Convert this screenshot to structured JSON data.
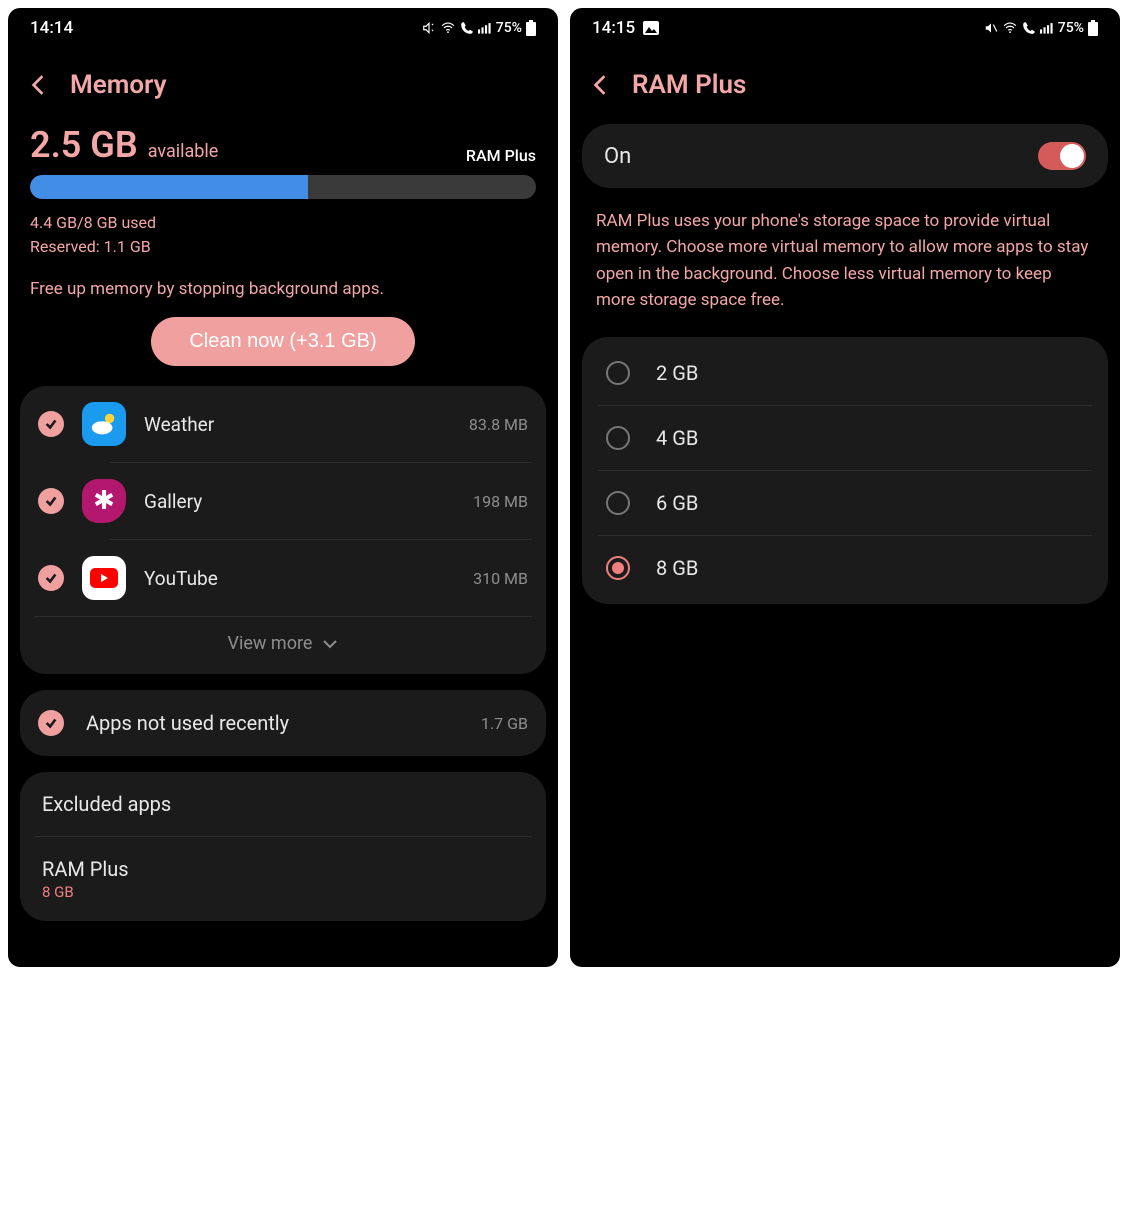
{
  "left": {
    "status": {
      "time": "14:14",
      "battery": "75%"
    },
    "title": "Memory",
    "available": {
      "big": "2.5 GB",
      "small": "available"
    },
    "ramplus_link": "RAM Plus",
    "used_line": "4.4 GB/8 GB used",
    "reserved_line": "Reserved: 1.1 GB",
    "hint": "Free up memory by stopping background apps.",
    "clean_label": "Clean now (+3.1 GB)",
    "apps": [
      {
        "name": "Weather",
        "size": "83.8 MB"
      },
      {
        "name": "Gallery",
        "size": "198 MB"
      },
      {
        "name": "YouTube",
        "size": "310 MB"
      }
    ],
    "view_more": "View more",
    "not_used": {
      "label": "Apps not used recently",
      "size": "1.7 GB"
    },
    "settings": [
      {
        "label": "Excluded apps",
        "sub": ""
      },
      {
        "label": "RAM Plus",
        "sub": "8 GB"
      }
    ]
  },
  "right": {
    "status": {
      "time": "14:15",
      "battery": "75%"
    },
    "title": "RAM Plus",
    "toggle": {
      "label": "On",
      "on": true
    },
    "description": "RAM Plus uses your phone's storage space to provide virtual memory. Choose more virtual memory to allow more apps to stay open in the background. Choose less virtual memory to keep more storage space free.",
    "options": [
      {
        "label": "2 GB",
        "selected": false
      },
      {
        "label": "4 GB",
        "selected": false
      },
      {
        "label": "6 GB",
        "selected": false
      },
      {
        "label": "8 GB",
        "selected": true
      }
    ]
  }
}
